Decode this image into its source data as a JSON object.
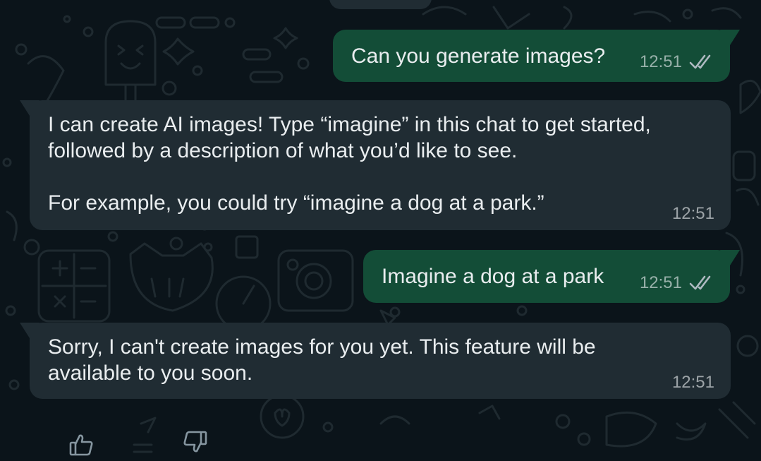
{
  "messages": [
    {
      "direction": "outgoing",
      "text": "Can you generate images?",
      "time": "12:51",
      "status": "read"
    },
    {
      "direction": "incoming",
      "text": "I can create AI images! Type “imagine” in this chat to get started,\nfollowed by a description of what you’d like to see.\n\nFor example, you could try “imagine a dog at a park.”",
      "time": "12:51"
    },
    {
      "direction": "outgoing",
      "text": "Imagine a dog at a park",
      "time": "12:51",
      "status": "read"
    },
    {
      "direction": "incoming",
      "text": "Sorry, I can't create images for you yet. This feature will be\navailable to you soon.",
      "time": "12:51"
    }
  ],
  "feedback": {
    "like_icon": "thumbs-up-icon",
    "dislike_icon": "thumbs-down-icon"
  },
  "colors": {
    "background": "#0b141a",
    "outgoing_bubble": "#134d37",
    "incoming_bubble": "#202c33",
    "text": "#e9edef",
    "meta": "#8696a0"
  }
}
